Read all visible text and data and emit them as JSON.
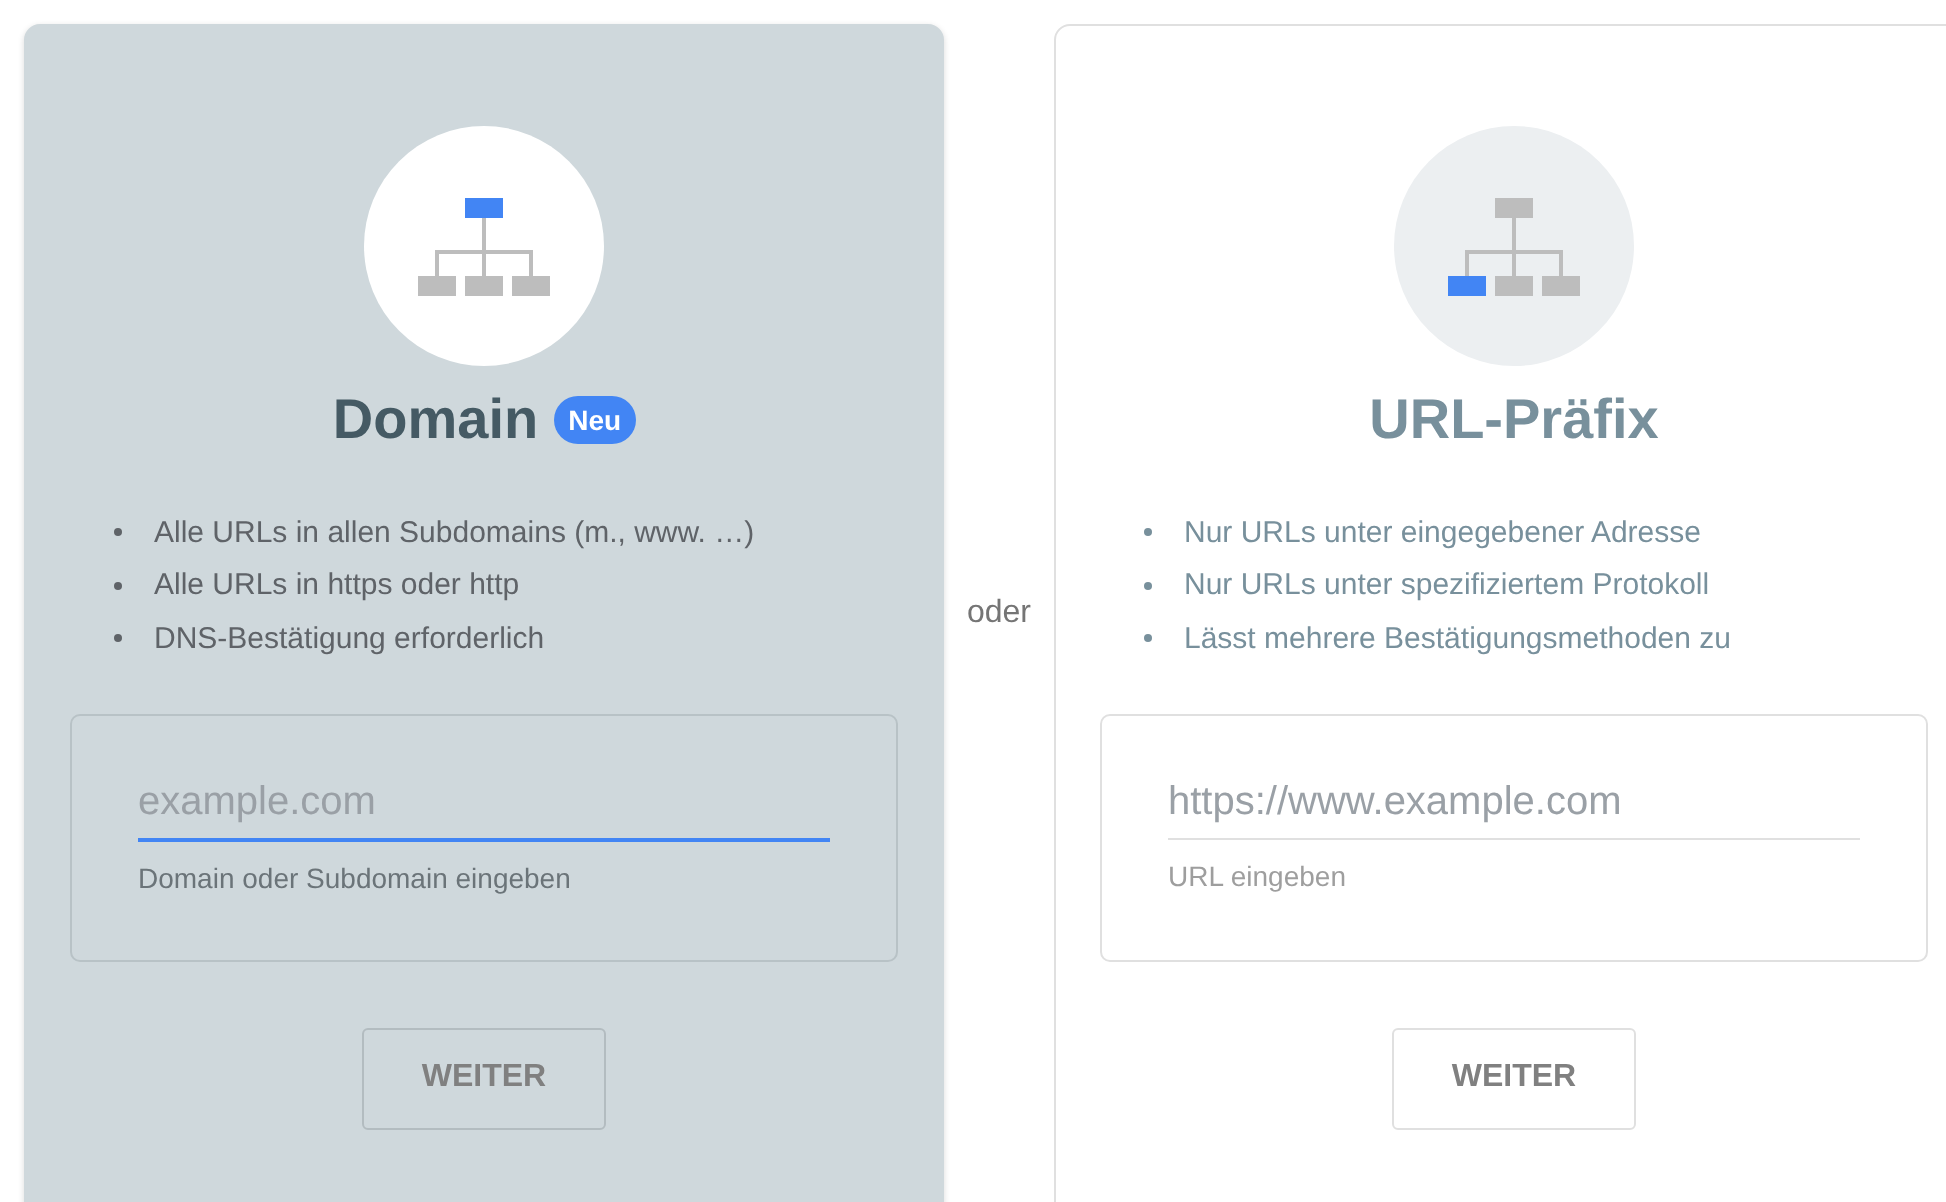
{
  "options": [
    {
      "kind": "domain",
      "selected": true,
      "title": "Domain",
      "badge": "Neu",
      "bullets": [
        "Alle URLs in allen Subdomains (m., www. …)",
        "Alle URLs in https oder http",
        "DNS-Bestätigung erforderlich"
      ],
      "input": {
        "placeholder": "example.com",
        "focused": true
      },
      "hint": "Domain oder Subdomain eingeben",
      "button": "WEITER"
    },
    {
      "kind": "prefix",
      "selected": false,
      "title": "URL-Präfix",
      "bullets": [
        "Nur URLs unter eingegebener Adresse",
        "Nur URLs unter spezifiziertem Protokoll",
        "Lässt mehrere Bestätigungsmethoden zu"
      ],
      "input": {
        "placeholder": "https://www.example.com",
        "focused": false
      },
      "hint": "URL eingeben",
      "button": "WEITER"
    }
  ],
  "separator": "oder"
}
